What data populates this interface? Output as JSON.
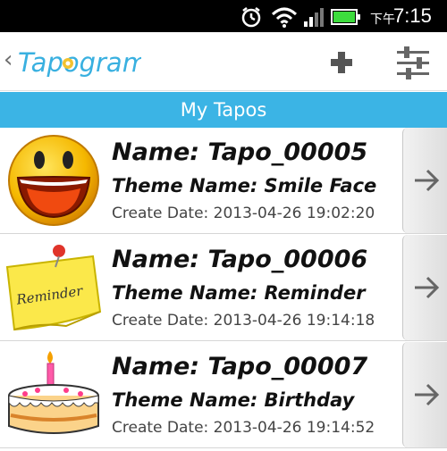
{
  "status_bar": {
    "time_prefix": "下午",
    "time": "7:15",
    "icons": [
      "alarm-icon",
      "wifi-icon",
      "signal-icon",
      "battery-icon"
    ]
  },
  "app_bar": {
    "back_glyph": "‹",
    "logo_text": "Tapogram",
    "add_icon": "plus-icon",
    "settings_icon": "sliders-icon"
  },
  "section": {
    "title": "My Tapos"
  },
  "tapos": [
    {
      "name": "Name: Tapo_00005",
      "theme": "Theme Name: Smile Face",
      "date": "Create Date: 2013-04-26 19:02:20",
      "thumbnail": "smile-face-thumbnail"
    },
    {
      "name": "Name: Tapo_00006",
      "theme": "Theme Name: Reminder",
      "date": "Create Date: 2013-04-26 19:14:18",
      "thumbnail": "reminder-note-thumbnail",
      "thumbnail_text": "Reminder"
    },
    {
      "name": "Name: Tapo_00007",
      "theme": "Theme Name: Birthday",
      "date": "Create Date: 2013-04-26 19:14:52",
      "thumbnail": "birthday-cake-thumbnail"
    }
  ],
  "colors": {
    "accent": "#3bb4e5",
    "logo": "#39b0e0",
    "status_bar": "#000000",
    "battery": "#3ddc3d"
  }
}
